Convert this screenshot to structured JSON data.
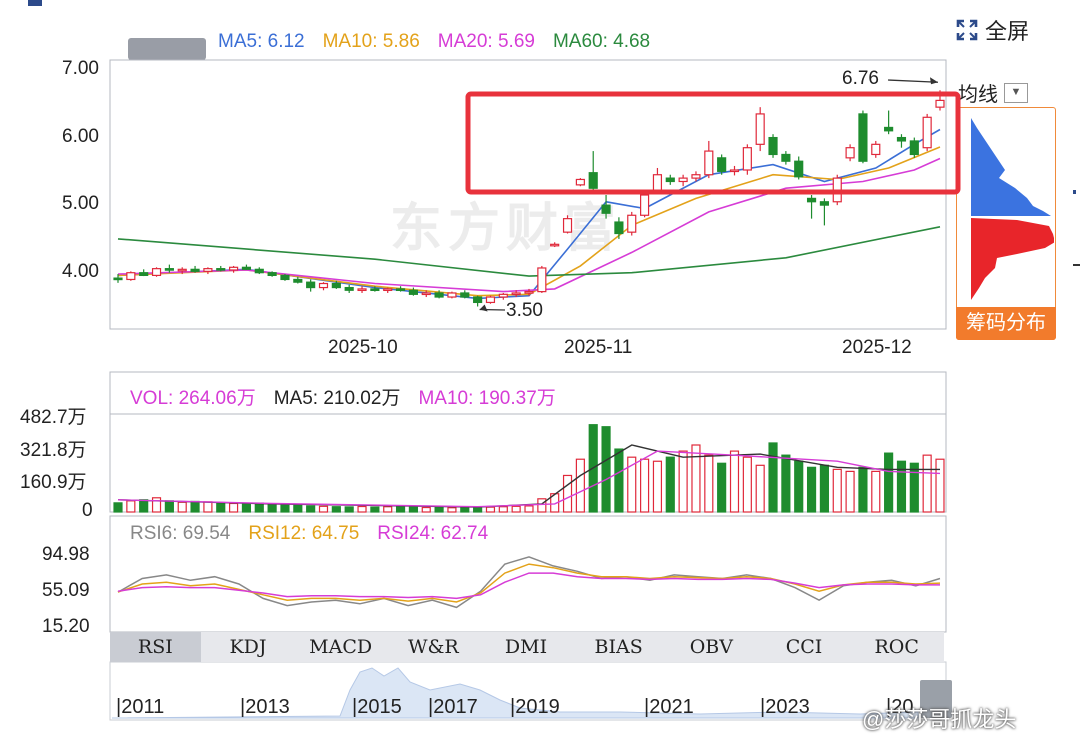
{
  "header": {
    "fullscreen_label": "全屏",
    "ma_line_label": "均线",
    "chip_label": "筹码分布"
  },
  "main": {
    "legend": [
      {
        "label": "MA5: 6.12",
        "color": "#3b6fd6"
      },
      {
        "label": "MA10: 5.86",
        "color": "#e3a21a"
      },
      {
        "label": "MA20: 5.69",
        "color": "#d63cd6"
      },
      {
        "label": "MA60: 4.68",
        "color": "#2b8a3e"
      }
    ],
    "high_label": "6.76",
    "low_label": "3.50"
  },
  "volume": {
    "legend": [
      {
        "label": "VOL: 264.06万",
        "color": "#d63cd6"
      },
      {
        "label": "MA5: 210.02万",
        "color": "#222222"
      },
      {
        "label": "MA10: 190.37万",
        "color": "#d63cd6"
      }
    ]
  },
  "rsi": {
    "legend": [
      {
        "label": "RSI6: 69.54",
        "color": "#888888"
      },
      {
        "label": "RSI12: 64.75",
        "color": "#e3a21a"
      },
      {
        "label": "RSI24: 62.74",
        "color": "#d63cd6"
      }
    ]
  },
  "tabs": [
    "RSI",
    "KDJ",
    "MACD",
    "W&R",
    "DMI",
    "BIAS",
    "OBV",
    "CCI",
    "ROC"
  ],
  "overview_years": [
    "2011",
    "2013",
    "2015",
    "2017",
    "2019",
    "2021",
    "2023",
    "20"
  ],
  "watermark": "东方财富",
  "weibo_handle": "@莎莎哥抓龙头",
  "chart_data": [
    {
      "type": "candlestick",
      "title": "",
      "ylim": [
        3.3,
        7.0
      ],
      "yticks": [
        "7.00",
        "6.00",
        "5.00",
        "4.00"
      ],
      "xticks": [
        "2025-10",
        "2025-11",
        "2025-12"
      ],
      "max": 6.76,
      "min": 3.5,
      "up_color": "#e0283a",
      "down_color": "#1e8c2e",
      "candles": [
        [
          3.92,
          3.98,
          3.85,
          3.9
        ],
        [
          3.9,
          4.02,
          3.88,
          4.0
        ],
        [
          4.0,
          4.05,
          3.95,
          3.96
        ],
        [
          3.96,
          4.08,
          3.94,
          4.06
        ],
        [
          4.06,
          4.12,
          4.0,
          4.04
        ],
        [
          4.04,
          4.08,
          3.98,
          4.05
        ],
        [
          4.05,
          4.1,
          4.0,
          4.02
        ],
        [
          4.02,
          4.08,
          3.98,
          4.06
        ],
        [
          4.06,
          4.1,
          4.02,
          4.04
        ],
        [
          4.04,
          4.1,
          4.0,
          4.08
        ],
        [
          4.08,
          4.12,
          4.04,
          4.05
        ],
        [
          4.05,
          4.08,
          3.98,
          4.0
        ],
        [
          4.0,
          4.02,
          3.94,
          3.96
        ],
        [
          3.96,
          3.98,
          3.88,
          3.9
        ],
        [
          3.9,
          3.94,
          3.84,
          3.86
        ],
        [
          3.86,
          3.9,
          3.72,
          3.78
        ],
        [
          3.78,
          3.86,
          3.74,
          3.84
        ],
        [
          3.84,
          3.88,
          3.76,
          3.78
        ],
        [
          3.78,
          3.82,
          3.7,
          3.74
        ],
        [
          3.74,
          3.8,
          3.7,
          3.76
        ],
        [
          3.76,
          3.8,
          3.72,
          3.74
        ],
        [
          3.74,
          3.78,
          3.7,
          3.76
        ],
        [
          3.76,
          3.8,
          3.72,
          3.74
        ],
        [
          3.74,
          3.78,
          3.66,
          3.68
        ],
        [
          3.68,
          3.74,
          3.64,
          3.7
        ],
        [
          3.7,
          3.74,
          3.62,
          3.64
        ],
        [
          3.64,
          3.72,
          3.62,
          3.7
        ],
        [
          3.7,
          3.74,
          3.62,
          3.64
        ],
        [
          3.64,
          3.66,
          3.5,
          3.56
        ],
        [
          3.56,
          3.66,
          3.54,
          3.64
        ],
        [
          3.64,
          3.7,
          3.6,
          3.68
        ],
        [
          3.68,
          3.74,
          3.64,
          3.7
        ],
        [
          3.7,
          3.76,
          3.66,
          3.72
        ],
        [
          3.72,
          4.1,
          3.7,
          4.07
        ],
        [
          4.4,
          4.45,
          4.38,
          4.42
        ],
        [
          4.6,
          4.85,
          4.58,
          4.8
        ],
        [
          5.3,
          5.4,
          5.28,
          5.38
        ],
        [
          5.48,
          5.8,
          5.2,
          5.25
        ],
        [
          5.0,
          5.15,
          4.8,
          4.88
        ],
        [
          4.75,
          4.82,
          4.5,
          4.58
        ],
        [
          4.6,
          4.9,
          4.55,
          4.85
        ],
        [
          4.85,
          5.2,
          4.82,
          5.15
        ],
        [
          5.2,
          5.55,
          5.18,
          5.45
        ],
        [
          5.4,
          5.45,
          5.3,
          5.35
        ],
        [
          5.35,
          5.45,
          5.28,
          5.4
        ],
        [
          5.4,
          5.5,
          5.35,
          5.45
        ],
        [
          5.45,
          5.95,
          5.4,
          5.8
        ],
        [
          5.7,
          5.75,
          5.45,
          5.5
        ],
        [
          5.5,
          5.58,
          5.44,
          5.52
        ],
        [
          5.52,
          5.9,
          5.45,
          5.85
        ],
        [
          5.9,
          6.45,
          5.8,
          6.35
        ],
        [
          6.0,
          6.05,
          5.7,
          5.75
        ],
        [
          5.75,
          5.8,
          5.6,
          5.65
        ],
        [
          5.65,
          5.72,
          5.38,
          5.42
        ],
        [
          5.1,
          5.15,
          4.8,
          5.05
        ],
        [
          5.05,
          5.1,
          4.7,
          5.0
        ],
        [
          5.05,
          5.45,
          5.0,
          5.4
        ],
        [
          5.7,
          5.9,
          5.65,
          5.85
        ],
        [
          6.35,
          6.4,
          5.62,
          5.65
        ],
        [
          5.75,
          5.95,
          5.7,
          5.9
        ],
        [
          6.15,
          6.4,
          6.05,
          6.1
        ],
        [
          6.0,
          6.05,
          5.85,
          5.95
        ],
        [
          5.95,
          6.0,
          5.7,
          5.75
        ],
        [
          5.85,
          6.35,
          5.8,
          6.3
        ],
        [
          6.45,
          6.7,
          6.4,
          6.55
        ]
      ],
      "ma_lines": [
        {
          "name": "MA5",
          "color": "#3b6fd6",
          "values": [
            [
              0,
              3.96
            ],
            [
              10,
              4.05
            ],
            [
              20,
              3.78
            ],
            [
              28,
              3.62
            ],
            [
              32,
              3.66
            ],
            [
              35,
              4.35
            ],
            [
              38,
              5.05
            ],
            [
              41,
              4.95
            ],
            [
              46,
              5.45
            ],
            [
              51,
              5.6
            ],
            [
              55,
              5.35
            ],
            [
              59,
              5.55
            ],
            [
              62,
              5.9
            ],
            [
              64,
              6.12
            ]
          ]
        },
        {
          "name": "MA10",
          "color": "#e3a21a",
          "values": [
            [
              0,
              3.96
            ],
            [
              10,
              4.04
            ],
            [
              20,
              3.8
            ],
            [
              28,
              3.66
            ],
            [
              32,
              3.68
            ],
            [
              36,
              4.1
            ],
            [
              40,
              4.7
            ],
            [
              45,
              5.1
            ],
            [
              51,
              5.45
            ],
            [
              56,
              5.38
            ],
            [
              60,
              5.55
            ],
            [
              64,
              5.86
            ]
          ]
        },
        {
          "name": "MA20",
          "color": "#d63cd6",
          "values": [
            [
              0,
              3.98
            ],
            [
              10,
              4.04
            ],
            [
              20,
              3.84
            ],
            [
              30,
              3.72
            ],
            [
              34,
              3.76
            ],
            [
              40,
              4.3
            ],
            [
              46,
              4.9
            ],
            [
              52,
              5.25
            ],
            [
              58,
              5.35
            ],
            [
              62,
              5.52
            ],
            [
              64,
              5.69
            ]
          ]
        },
        {
          "name": "MA60",
          "color": "#2b8a3e",
          "values": [
            [
              0,
              4.5
            ],
            [
              20,
              4.2
            ],
            [
              32,
              3.95
            ],
            [
              40,
              4.0
            ],
            [
              52,
              4.22
            ],
            [
              64,
              4.68
            ]
          ]
        }
      ]
    },
    {
      "type": "bar",
      "title": "VOL",
      "ylim": [
        0,
        482.7
      ],
      "yticks": [
        "482.7万",
        "321.8万",
        "160.9万",
        "0"
      ],
      "values": [
        45,
        55,
        60,
        70,
        55,
        48,
        52,
        50,
        45,
        42,
        40,
        44,
        38,
        36,
        34,
        30,
        28,
        26,
        25,
        27,
        24,
        26,
        25,
        24,
        22,
        23,
        21,
        22,
        20,
        24,
        26,
        28,
        30,
        65,
        90,
        180,
        260,
        430,
        420,
        310,
        270,
        260,
        250,
        270,
        300,
        330,
        280,
        240,
        300,
        270,
        230,
        340,
        280,
        250,
        220,
        230,
        210,
        200,
        220,
        200,
        290,
        250,
        240,
        280,
        260
      ],
      "ma5": [
        [
          0,
          60
        ],
        [
          12,
          40
        ],
        [
          28,
          24
        ],
        [
          33,
          40
        ],
        [
          36,
          180
        ],
        [
          40,
          330
        ],
        [
          44,
          270
        ],
        [
          50,
          285
        ],
        [
          56,
          220
        ],
        [
          60,
          210
        ],
        [
          64,
          210
        ]
      ],
      "ma10": [
        [
          0,
          60
        ],
        [
          12,
          42
        ],
        [
          28,
          26
        ],
        [
          34,
          40
        ],
        [
          38,
          160
        ],
        [
          42,
          300
        ],
        [
          48,
          280
        ],
        [
          56,
          250
        ],
        [
          60,
          200
        ],
        [
          64,
          190
        ]
      ]
    },
    {
      "type": "line",
      "title": "RSI",
      "ylim": [
        15.2,
        94.98
      ],
      "yticks": [
        "94.98",
        "55.09",
        "15.20"
      ],
      "series": [
        {
          "name": "RSI6",
          "color": "#888888",
          "values": [
            55,
            70,
            74,
            68,
            72,
            64,
            48,
            40,
            44,
            46,
            42,
            48,
            40,
            46,
            38,
            56,
            86,
            94,
            84,
            78,
            70,
            72,
            68,
            74,
            72,
            70,
            74,
            70,
            60,
            46,
            62,
            66,
            68,
            62,
            70
          ]
        },
        {
          "name": "RSI12",
          "color": "#e3a21a",
          "values": [
            55,
            64,
            66,
            62,
            64,
            58,
            52,
            46,
            48,
            48,
            46,
            48,
            45,
            48,
            44,
            54,
            76,
            86,
            82,
            76,
            72,
            72,
            70,
            72,
            71,
            70,
            72,
            70,
            64,
            56,
            63,
            66,
            66,
            64,
            65
          ]
        },
        {
          "name": "RSI24",
          "color": "#d63cd6",
          "values": [
            56,
            60,
            61,
            60,
            60,
            57,
            54,
            50,
            51,
            51,
            50,
            50,
            49,
            50,
            48,
            52,
            66,
            76,
            76,
            72,
            70,
            70,
            69,
            70,
            69,
            69,
            70,
            69,
            65,
            60,
            63,
            64,
            64,
            63,
            63
          ]
        }
      ]
    }
  ]
}
